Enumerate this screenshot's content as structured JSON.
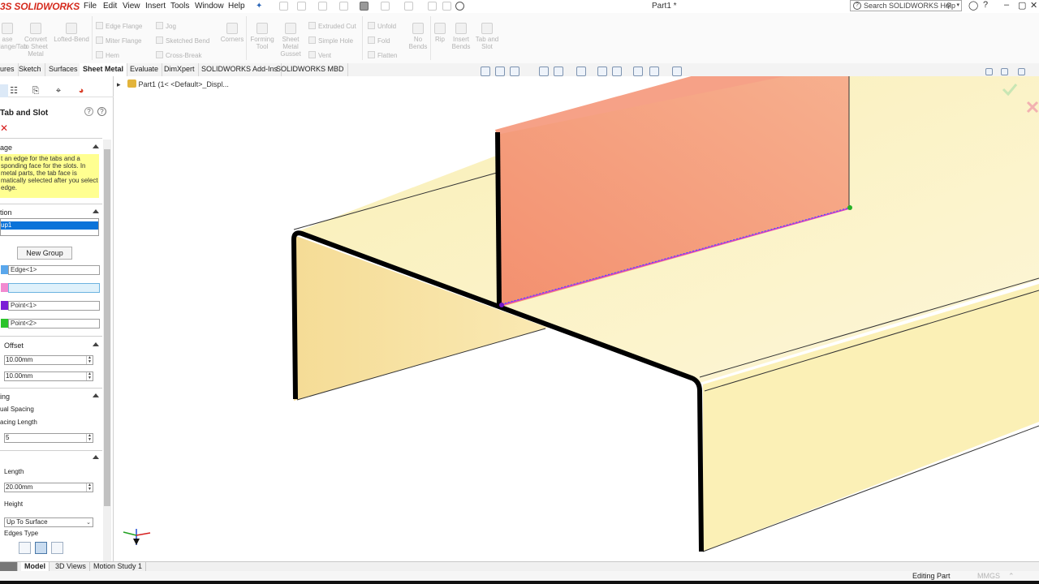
{
  "app": {
    "logo_text": "SOLIDWORKS",
    "logo_prefix": "3S",
    "document_title": "Part1 *",
    "search_placeholder": "Search SOLIDWORKS Help"
  },
  "menu": [
    "File",
    "Edit",
    "View",
    "Insert",
    "Tools",
    "Window",
    "Help"
  ],
  "ribbon": {
    "large_buttons": [
      {
        "label": "ase Flange/Tab"
      },
      {
        "label": "Convert to Sheet Metal"
      },
      {
        "label": "Lofted-Bend"
      },
      {
        "label": "Corners"
      },
      {
        "label": "Forming Tool"
      },
      {
        "label": "Sheet Metal Gusset"
      },
      {
        "label": "No Bends"
      },
      {
        "label": "Rip"
      },
      {
        "label": "Insert Bends"
      },
      {
        "label": "Tab and Slot"
      }
    ],
    "small_buttons": [
      {
        "label": "Edge Flange"
      },
      {
        "label": "Miter Flange"
      },
      {
        "label": "Hem"
      },
      {
        "label": "Jog"
      },
      {
        "label": "Sketched Bend"
      },
      {
        "label": "Cross-Break"
      },
      {
        "label": "Extruded Cut"
      },
      {
        "label": "Simple Hole"
      },
      {
        "label": "Vent"
      },
      {
        "label": "Unfold"
      },
      {
        "label": "Fold"
      },
      {
        "label": "Flatten"
      }
    ]
  },
  "command_tabs": [
    {
      "label": "ures"
    },
    {
      "label": "Sketch"
    },
    {
      "label": "Surfaces"
    },
    {
      "label": "Sheet Metal",
      "active": true
    },
    {
      "label": "Evaluate"
    },
    {
      "label": "DimXpert"
    },
    {
      "label": "SOLIDWORKS Add-Ins"
    },
    {
      "label": "SOLIDWORKS MBD"
    }
  ],
  "tree": {
    "item": "Part1  (1< <Default>_Displ..."
  },
  "property_manager": {
    "title": "Tab and Slot",
    "message_header": "age",
    "message": "t an edge for the tabs and a sponding face for the slots. In metal parts, the tab face is matically selected after you select edge.",
    "selection_header": "tion",
    "group_item": "up1",
    "new_group_button": "New Group",
    "fields": {
      "edge": "Edge<1>",
      "face": "",
      "point1": "Point<1>",
      "point2": "Point<2>"
    },
    "offset_header": "Offset",
    "offset_start": "10.00mm",
    "offset_end": "10.00mm",
    "spacing_header": "ing",
    "equal_spacing_label": "ual Spacing",
    "spacing_length_label": "acing Length",
    "spacing_value": "5",
    "length_label": "Length",
    "length_value": "20.00mm",
    "height_label": "Height",
    "height_value": "Up To Surface",
    "edges_type_label": "Edges Type"
  },
  "bottom_tabs": [
    {
      "label": "Model",
      "active": true
    },
    {
      "label": "3D Views"
    },
    {
      "label": "Motion Study 1"
    }
  ],
  "status": {
    "editing": "Editing Part",
    "units": "MMGS"
  },
  "colors": {
    "accent_blue": "#0a73d9",
    "tab_face": "#f08f72",
    "base_face": "#f9e9a6",
    "message_bg": "#ffff91"
  }
}
